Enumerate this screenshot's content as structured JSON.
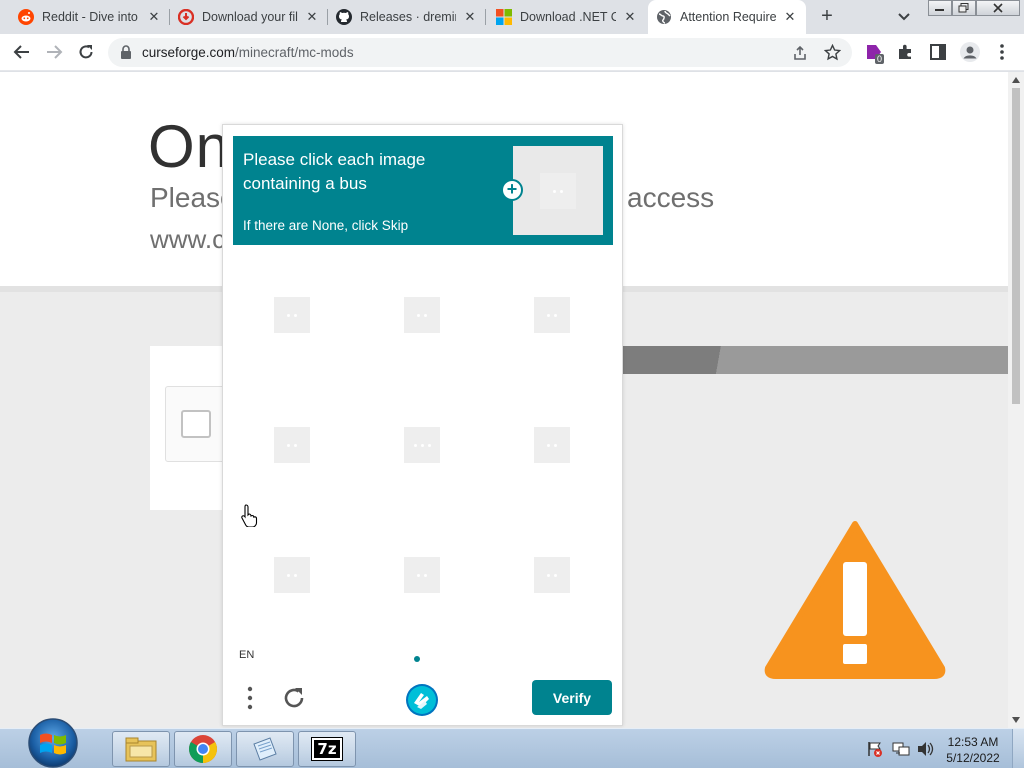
{
  "browser": {
    "tabs": [
      {
        "title": "Reddit - Dive into anything",
        "icon": "reddit-icon"
      },
      {
        "title": "Download your files",
        "icon": "download-site-icon"
      },
      {
        "title": "Releases · dreminder",
        "icon": "github-icon"
      },
      {
        "title": "Download .NET Core",
        "icon": "microsoft-icon"
      },
      {
        "title": "Attention Required",
        "icon": "globe-icon",
        "active": true
      }
    ],
    "url_domain": "curseforge.com",
    "url_path": "/minecraft/mc-mods",
    "extension_badge": "0"
  },
  "page": {
    "heading": "On",
    "subheading_start": "Please",
    "subheading_end": "access",
    "site_prefix": "www.c"
  },
  "captcha": {
    "prompt": "Please click each image containing a bus",
    "subprompt": "If there are None, click Skip",
    "language": "EN",
    "verify_label": "Verify",
    "accent_color": "#00838f"
  },
  "taskbar": {
    "time": "12:53 AM",
    "date": "5/12/2022",
    "apps": [
      "windows-explorer-icon",
      "chrome-icon",
      "notepad-icon",
      "7zip-icon"
    ],
    "app_7zip_label": "7z"
  },
  "warning_color": "#f7931e"
}
